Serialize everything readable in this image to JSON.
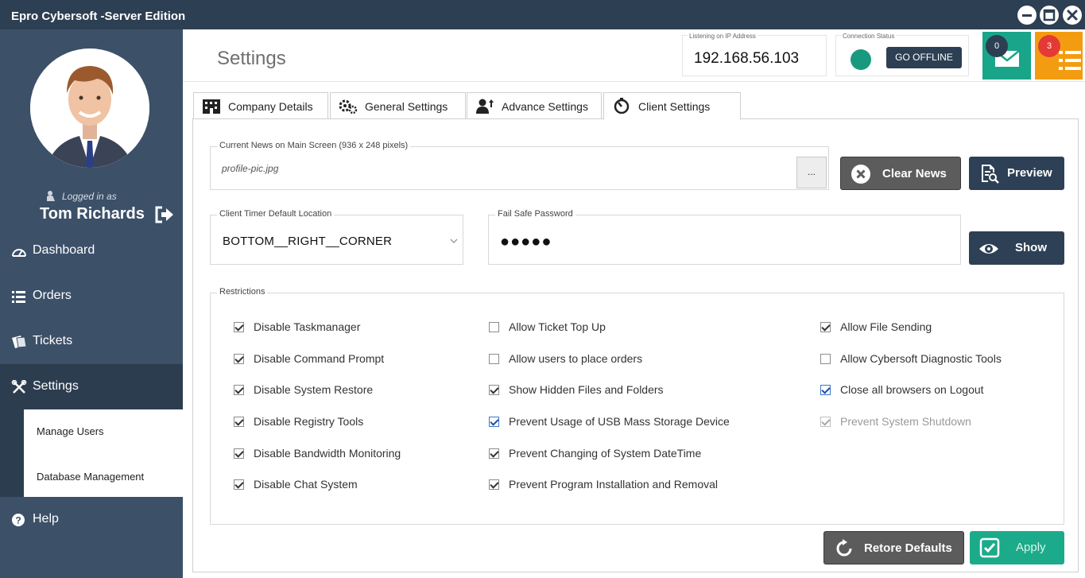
{
  "window": {
    "title": "Epro Cybersoft -Server Edition"
  },
  "sidebar": {
    "logged_in_label": "Logged in as",
    "user_name": "Tom Richards",
    "nav": [
      {
        "label": "Dashboard",
        "icon": "dashboard-icon"
      },
      {
        "label": "Orders",
        "icon": "list-icon"
      },
      {
        "label": "Tickets",
        "icon": "tickets-icon"
      },
      {
        "label": "Settings",
        "icon": "wrench-icon",
        "active": true
      },
      {
        "label": "Help",
        "icon": "help-icon"
      }
    ],
    "sub_items": [
      "Manage Users",
      "Database Management"
    ]
  },
  "header": {
    "title": "Settings",
    "ip_label": "Listening on IP Address",
    "ip_value": "192.168.56.103",
    "connection_label": "Connection Status",
    "go_offline": "GO OFFLINE",
    "mail_count": "0",
    "list_count": "3"
  },
  "tabs": [
    {
      "label": "Company Details",
      "icon": "building-icon"
    },
    {
      "label": "General Settings",
      "icon": "gears-icon"
    },
    {
      "label": "Advance Settings",
      "icon": "user-upgrade-icon"
    },
    {
      "label": "Client Settings",
      "icon": "timer-icon",
      "active": true
    }
  ],
  "news": {
    "label": "Current News on Main Screen (936 x 248 pixels)",
    "file": "profile-pic.jpg",
    "browse": "...",
    "clear_button": "Clear News",
    "preview_button": "Preview"
  },
  "timer_location": {
    "label": "Client Timer Default Location",
    "value": "BOTTOM__RIGHT__CORNER"
  },
  "failsafe": {
    "label": "Fail Safe Password",
    "value": "●●●●●",
    "show_button": "Show"
  },
  "restrictions": {
    "label": "Restrictions",
    "col1": [
      {
        "label": "Disable Taskmanager",
        "checked": true
      },
      {
        "label": "Disable Command Prompt",
        "checked": true
      },
      {
        "label": "Disable System Restore",
        "checked": true
      },
      {
        "label": "Disable Registry Tools",
        "checked": true
      },
      {
        "label": "Disable Bandwidth Monitoring",
        "checked": true
      },
      {
        "label": "Disable Chat System",
        "checked": true
      }
    ],
    "col2": [
      {
        "label": "Allow Ticket Top Up",
        "checked": false
      },
      {
        "label": "Allow users to place orders",
        "checked": false
      },
      {
        "label": "Show Hidden Files and Folders",
        "checked": true
      },
      {
        "label": "Prevent Usage of USB Mass Storage Device",
        "checked": true,
        "focused": true
      },
      {
        "label": "Prevent Changing of System DateTime",
        "checked": true
      },
      {
        "label": "Prevent Program Installation and Removal",
        "checked": true
      }
    ],
    "col3": [
      {
        "label": "Allow File Sending",
        "checked": true
      },
      {
        "label": "Allow Cybersoft Diagnostic Tools",
        "checked": false
      },
      {
        "label": "Close all browsers on Logout",
        "checked": true,
        "focused": true
      },
      {
        "label": "Prevent System Shutdown",
        "checked": true,
        "disabled": true
      }
    ]
  },
  "footer": {
    "restore_button": "Retore Defaults",
    "apply_button": "Apply"
  },
  "colors": {
    "sidebar": "#3c5068",
    "titlebar": "#2d3f52",
    "accent_green": "#1bab8a",
    "accent_orange": "#f39c12"
  }
}
